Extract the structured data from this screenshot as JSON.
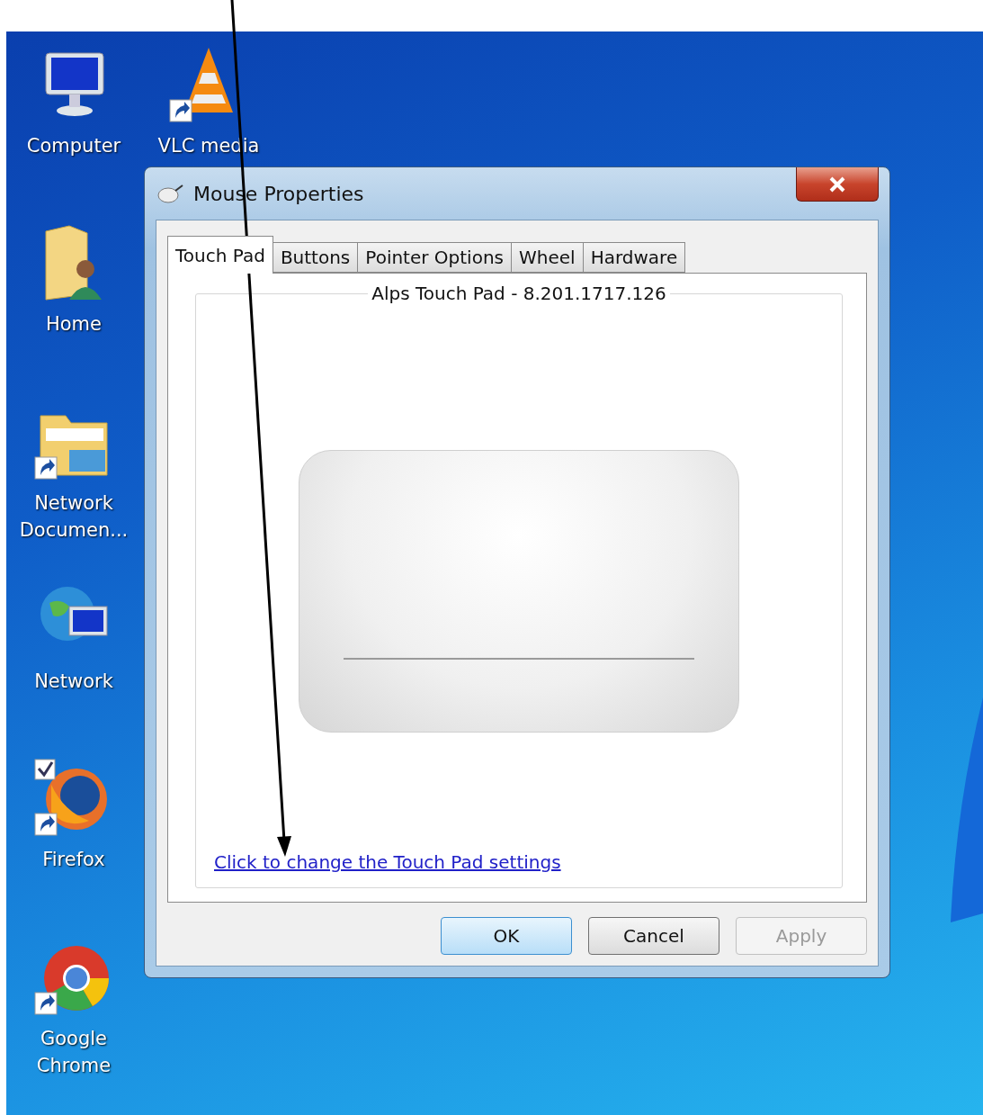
{
  "desktop": {
    "columns": [
      {
        "icons": [
          {
            "kind": "computer",
            "label": "Computer",
            "shortcut": false
          },
          {
            "kind": "user-folder",
            "label": "Home",
            "shortcut": false
          },
          {
            "kind": "folder",
            "label": "Network Documen...",
            "shortcut": true
          },
          {
            "kind": "network",
            "label": "Network",
            "shortcut": false
          },
          {
            "kind": "firefox",
            "label": "Firefox",
            "shortcut": true
          },
          {
            "kind": "chrome",
            "label": "Google Chrome",
            "shortcut": true
          }
        ]
      },
      {
        "icons": [
          {
            "kind": "cone",
            "label": "VLC media",
            "shortcut": true
          }
        ]
      }
    ]
  },
  "dialog": {
    "title": "Mouse Properties",
    "tabs": [
      {
        "label": "Touch Pad",
        "selected": true
      },
      {
        "label": "Buttons",
        "selected": false
      },
      {
        "label": "Pointer Options",
        "selected": false
      },
      {
        "label": "Wheel",
        "selected": false
      },
      {
        "label": "Hardware",
        "selected": false
      }
    ],
    "group_caption": "Alps Touch Pad - 8.201.1717.126",
    "link": "Click to change the Touch Pad settings",
    "buttons": [
      {
        "label": "OK",
        "default": true,
        "disabled": false
      },
      {
        "label": "Cancel",
        "default": false,
        "disabled": false
      },
      {
        "label": "Apply",
        "default": false,
        "disabled": true
      }
    ]
  }
}
